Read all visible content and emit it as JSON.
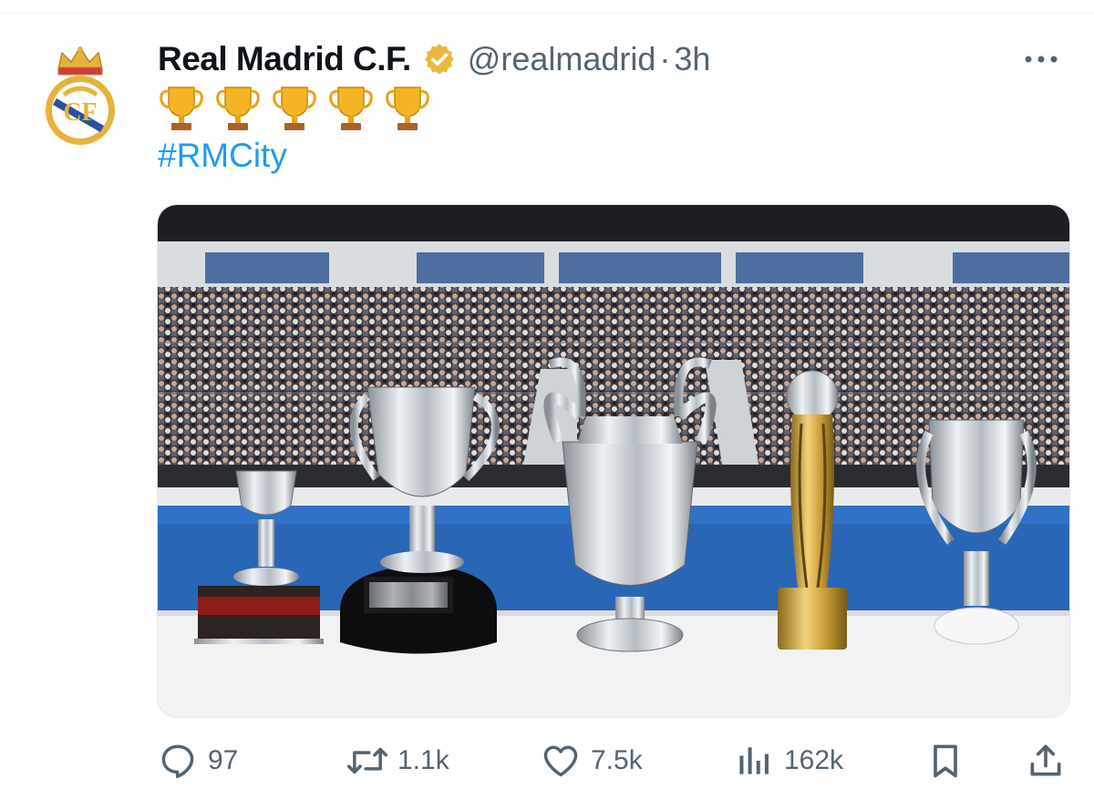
{
  "tweet": {
    "display_name": "Real Madrid C.F.",
    "handle": "@realmadrid",
    "separator": "·",
    "time": "3h",
    "trophy_emoji_count": 5,
    "hashtag": "#RMCity",
    "verified_badge_color": "#e8b93b",
    "hashtag_color": "#1d9bf0"
  },
  "actions": {
    "replies": "97",
    "retweets": "1.1k",
    "likes": "7.5k",
    "views": "162k"
  },
  "icons": [
    "more-icon",
    "reply-icon",
    "retweet-icon",
    "like-icon",
    "views-icon",
    "bookmark-icon",
    "share-icon",
    "verified-badge-icon",
    "trophy-emoji-icon"
  ]
}
